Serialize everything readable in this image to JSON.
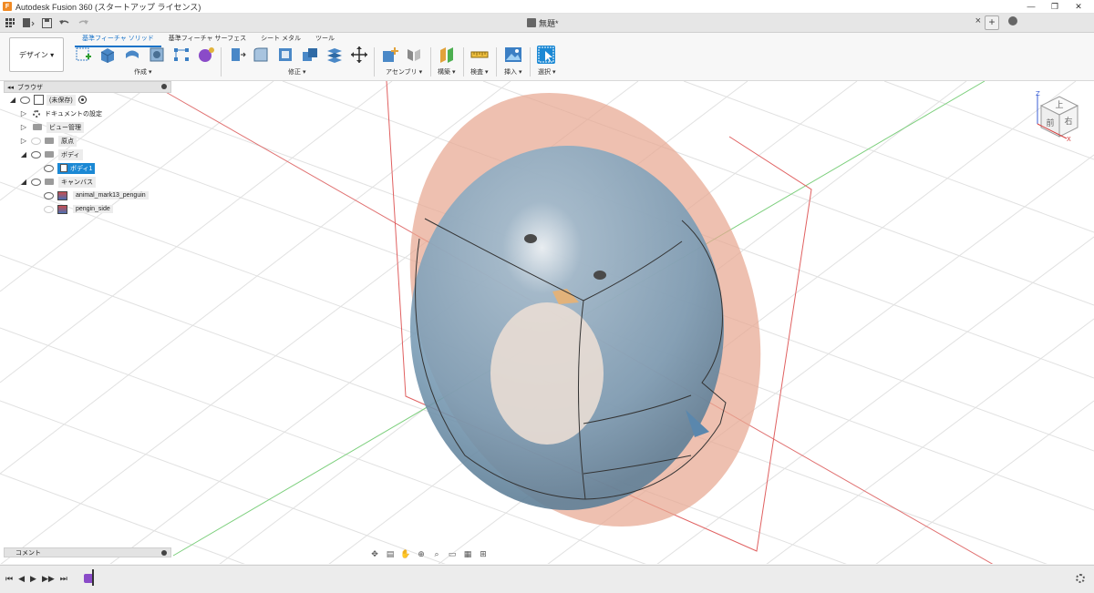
{
  "app": {
    "title": "Autodesk Fusion 360 (スタートアップ ライセンス)",
    "window_controls": [
      "—",
      "❐",
      "✕"
    ]
  },
  "document": {
    "tab_title": "無題*",
    "close_glyph": "×",
    "add_glyph": "+"
  },
  "ribbon": {
    "workspace": "デザイン ▾",
    "tabs": [
      "基準フィーチャ ソリッド",
      "基準フィーチャ サーフェス",
      "シート メタル",
      "ツール"
    ],
    "groups": {
      "create": "作成 ▾",
      "modify": "修正 ▾",
      "assemble": "アセンブリ ▾",
      "construct": "構築 ▾",
      "inspect": "検査 ▾",
      "insert": "挿入 ▾",
      "select": "選択 ▾"
    }
  },
  "browser": {
    "title": "ブラウザ",
    "root": "(未保存)",
    "items": [
      {
        "label": "ドキュメントの設定"
      },
      {
        "label": "ビュー管理"
      },
      {
        "label": "原点"
      },
      {
        "label": "ボディ"
      },
      {
        "label": "ボディ1"
      },
      {
        "label": "キャンバス"
      },
      {
        "label": "animal_mark13_penguin"
      },
      {
        "label": "pengin_side"
      }
    ]
  },
  "comments": {
    "title": "コメント"
  },
  "viewcube": {
    "top": "上",
    "front": "前",
    "right": "右",
    "axis_z": "Z",
    "axis_x": "X"
  },
  "timeline": {
    "buttons": [
      "⏮",
      "◀",
      "▶",
      "▶▶",
      "⏭"
    ]
  },
  "colors": {
    "accent": "#1b88d4",
    "canvas_peach": "#e8a891",
    "body_blue": "#7c9fb8",
    "grid_red": "#e06060",
    "grid_green": "#6cc06c"
  }
}
